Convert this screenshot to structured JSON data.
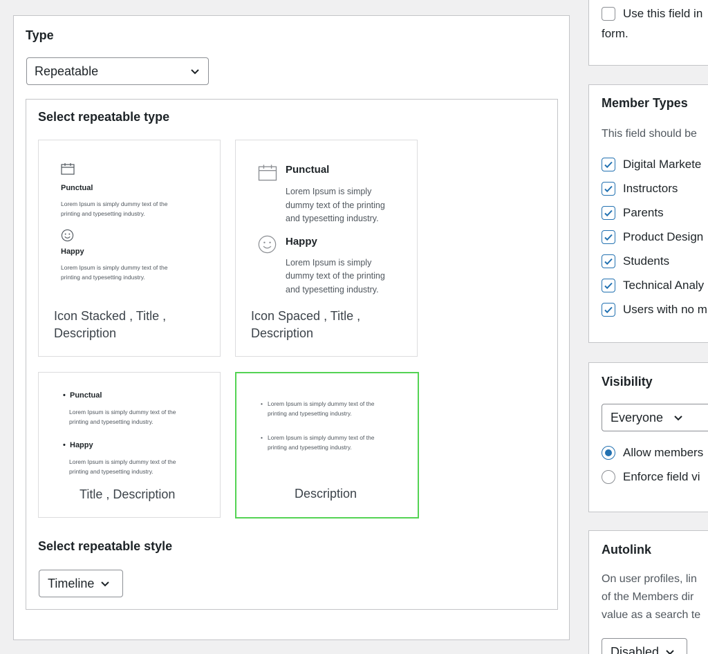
{
  "type_section": {
    "label": "Type",
    "selected": "Repeatable"
  },
  "repeatable_type": {
    "heading": "Select repeatable type",
    "cards": [
      {
        "caption_line1": "Icon Stacked , Title ,",
        "caption_line2": "Description",
        "item1_title": "Punctual",
        "item1_line1": "Lorem Ipsum is simply dummy text of the",
        "item1_line2": "printing and typesetting industry.",
        "item2_title": "Happy",
        "item2_line1": "Lorem Ipsum is simply dummy text of the",
        "item2_line2": "printing and typesetting industry."
      },
      {
        "caption_line1": "Icon Spaced , Title ,",
        "caption_line2": "Description",
        "item1_title": "Punctual",
        "item1_line1": "Lorem Ipsum is simply",
        "item1_line2": "dummy text of the printing",
        "item1_line3": "and typesetting industry.",
        "item2_title": "Happy",
        "item2_line1": "Lorem Ipsum is simply",
        "item2_line2": "dummy text of the printing",
        "item2_line3": "and typesetting industry."
      },
      {
        "caption": "Title , Description",
        "item1_title": "Punctual",
        "item1_line1": "Lorem Ipsum is simply dummy text of the",
        "item1_line2": "printing and typesetting industry.",
        "item2_title": "Happy",
        "item2_line1": "Lorem Ipsum is simply dummy text of the",
        "item2_line2": "printing and typesetting industry."
      },
      {
        "caption": "Description",
        "selected": true,
        "item1_line1": "Lorem Ipsum is simply dummy text of the",
        "item1_line2": "printing and typesetting industry.",
        "item2_line1": "Lorem Ipsum is simply dummy text of the",
        "item2_line2": "printing and typesetting industry."
      }
    ]
  },
  "repeatable_style": {
    "heading": "Select repeatable style",
    "selected": "Timeline"
  },
  "signup": {
    "label_line1": "Use this field in",
    "label_line2": "form."
  },
  "member_types": {
    "title": "Member Types",
    "description": "This field should be",
    "items": [
      "Digital Markete",
      "Instructors",
      "Parents",
      "Product Design",
      "Students",
      "Technical Analy",
      "Users with no m"
    ]
  },
  "visibility": {
    "title": "Visibility",
    "selected": "Everyone",
    "options": [
      "Allow members",
      "Enforce field vi"
    ]
  },
  "autolink": {
    "title": "Autolink",
    "line1": "On user profiles, lin",
    "line2": "of the Members dir",
    "line3": "value as a search te",
    "selected": "Disabled"
  },
  "colors": {
    "accent": "#2271b1",
    "selected_card": "#53d353",
    "border": "#c3c4c7"
  }
}
